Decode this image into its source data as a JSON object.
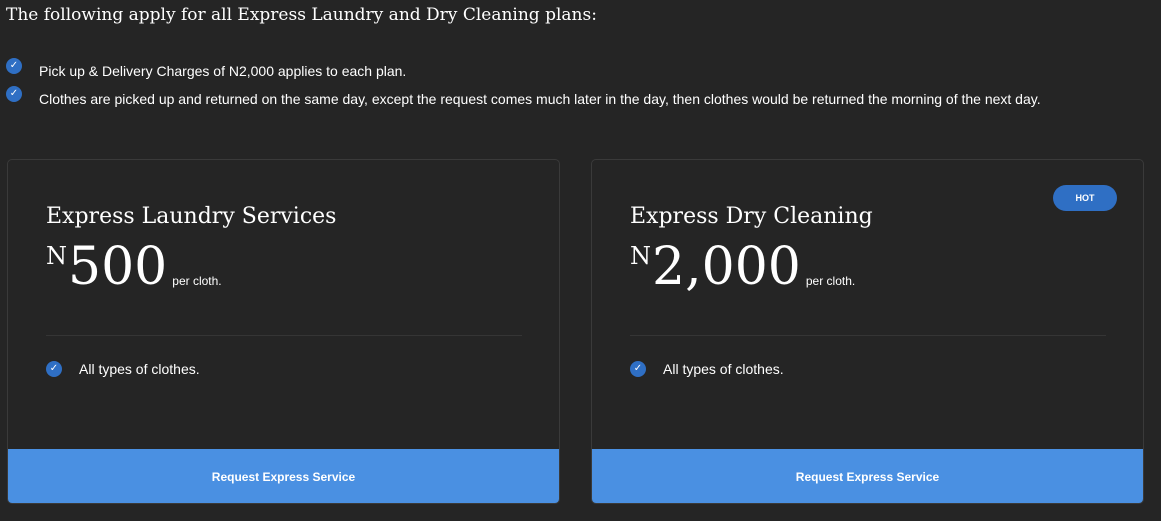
{
  "heading": "The following apply for all Express Laundry and Dry Cleaning plans:",
  "notes": [
    "Pick up & Delivery Charges of N2,000 applies to each plan.",
    "Clothes are picked up and returned on the same day, except the request comes much later in the day, then clothes would be returned the morning of the next day."
  ],
  "check_glyph": "✓",
  "icons": {
    "check": "check-circle-icon"
  },
  "colors": {
    "background": "#252525",
    "accent": "#4a90e2",
    "badge": "#2f6fc4",
    "card_border": "#3a3a3a"
  },
  "plans": [
    {
      "title": "Express Laundry Services",
      "currency": "N",
      "amount": "500",
      "unit": "per cloth.",
      "features": [
        "All types of clothes."
      ],
      "cta": "Request Express Service",
      "badge": ""
    },
    {
      "title": "Express Dry Cleaning",
      "currency": "N",
      "amount": "2,000",
      "unit": "per cloth.",
      "features": [
        "All types of clothes."
      ],
      "cta": "Request Express Service",
      "badge": "HOT"
    }
  ]
}
